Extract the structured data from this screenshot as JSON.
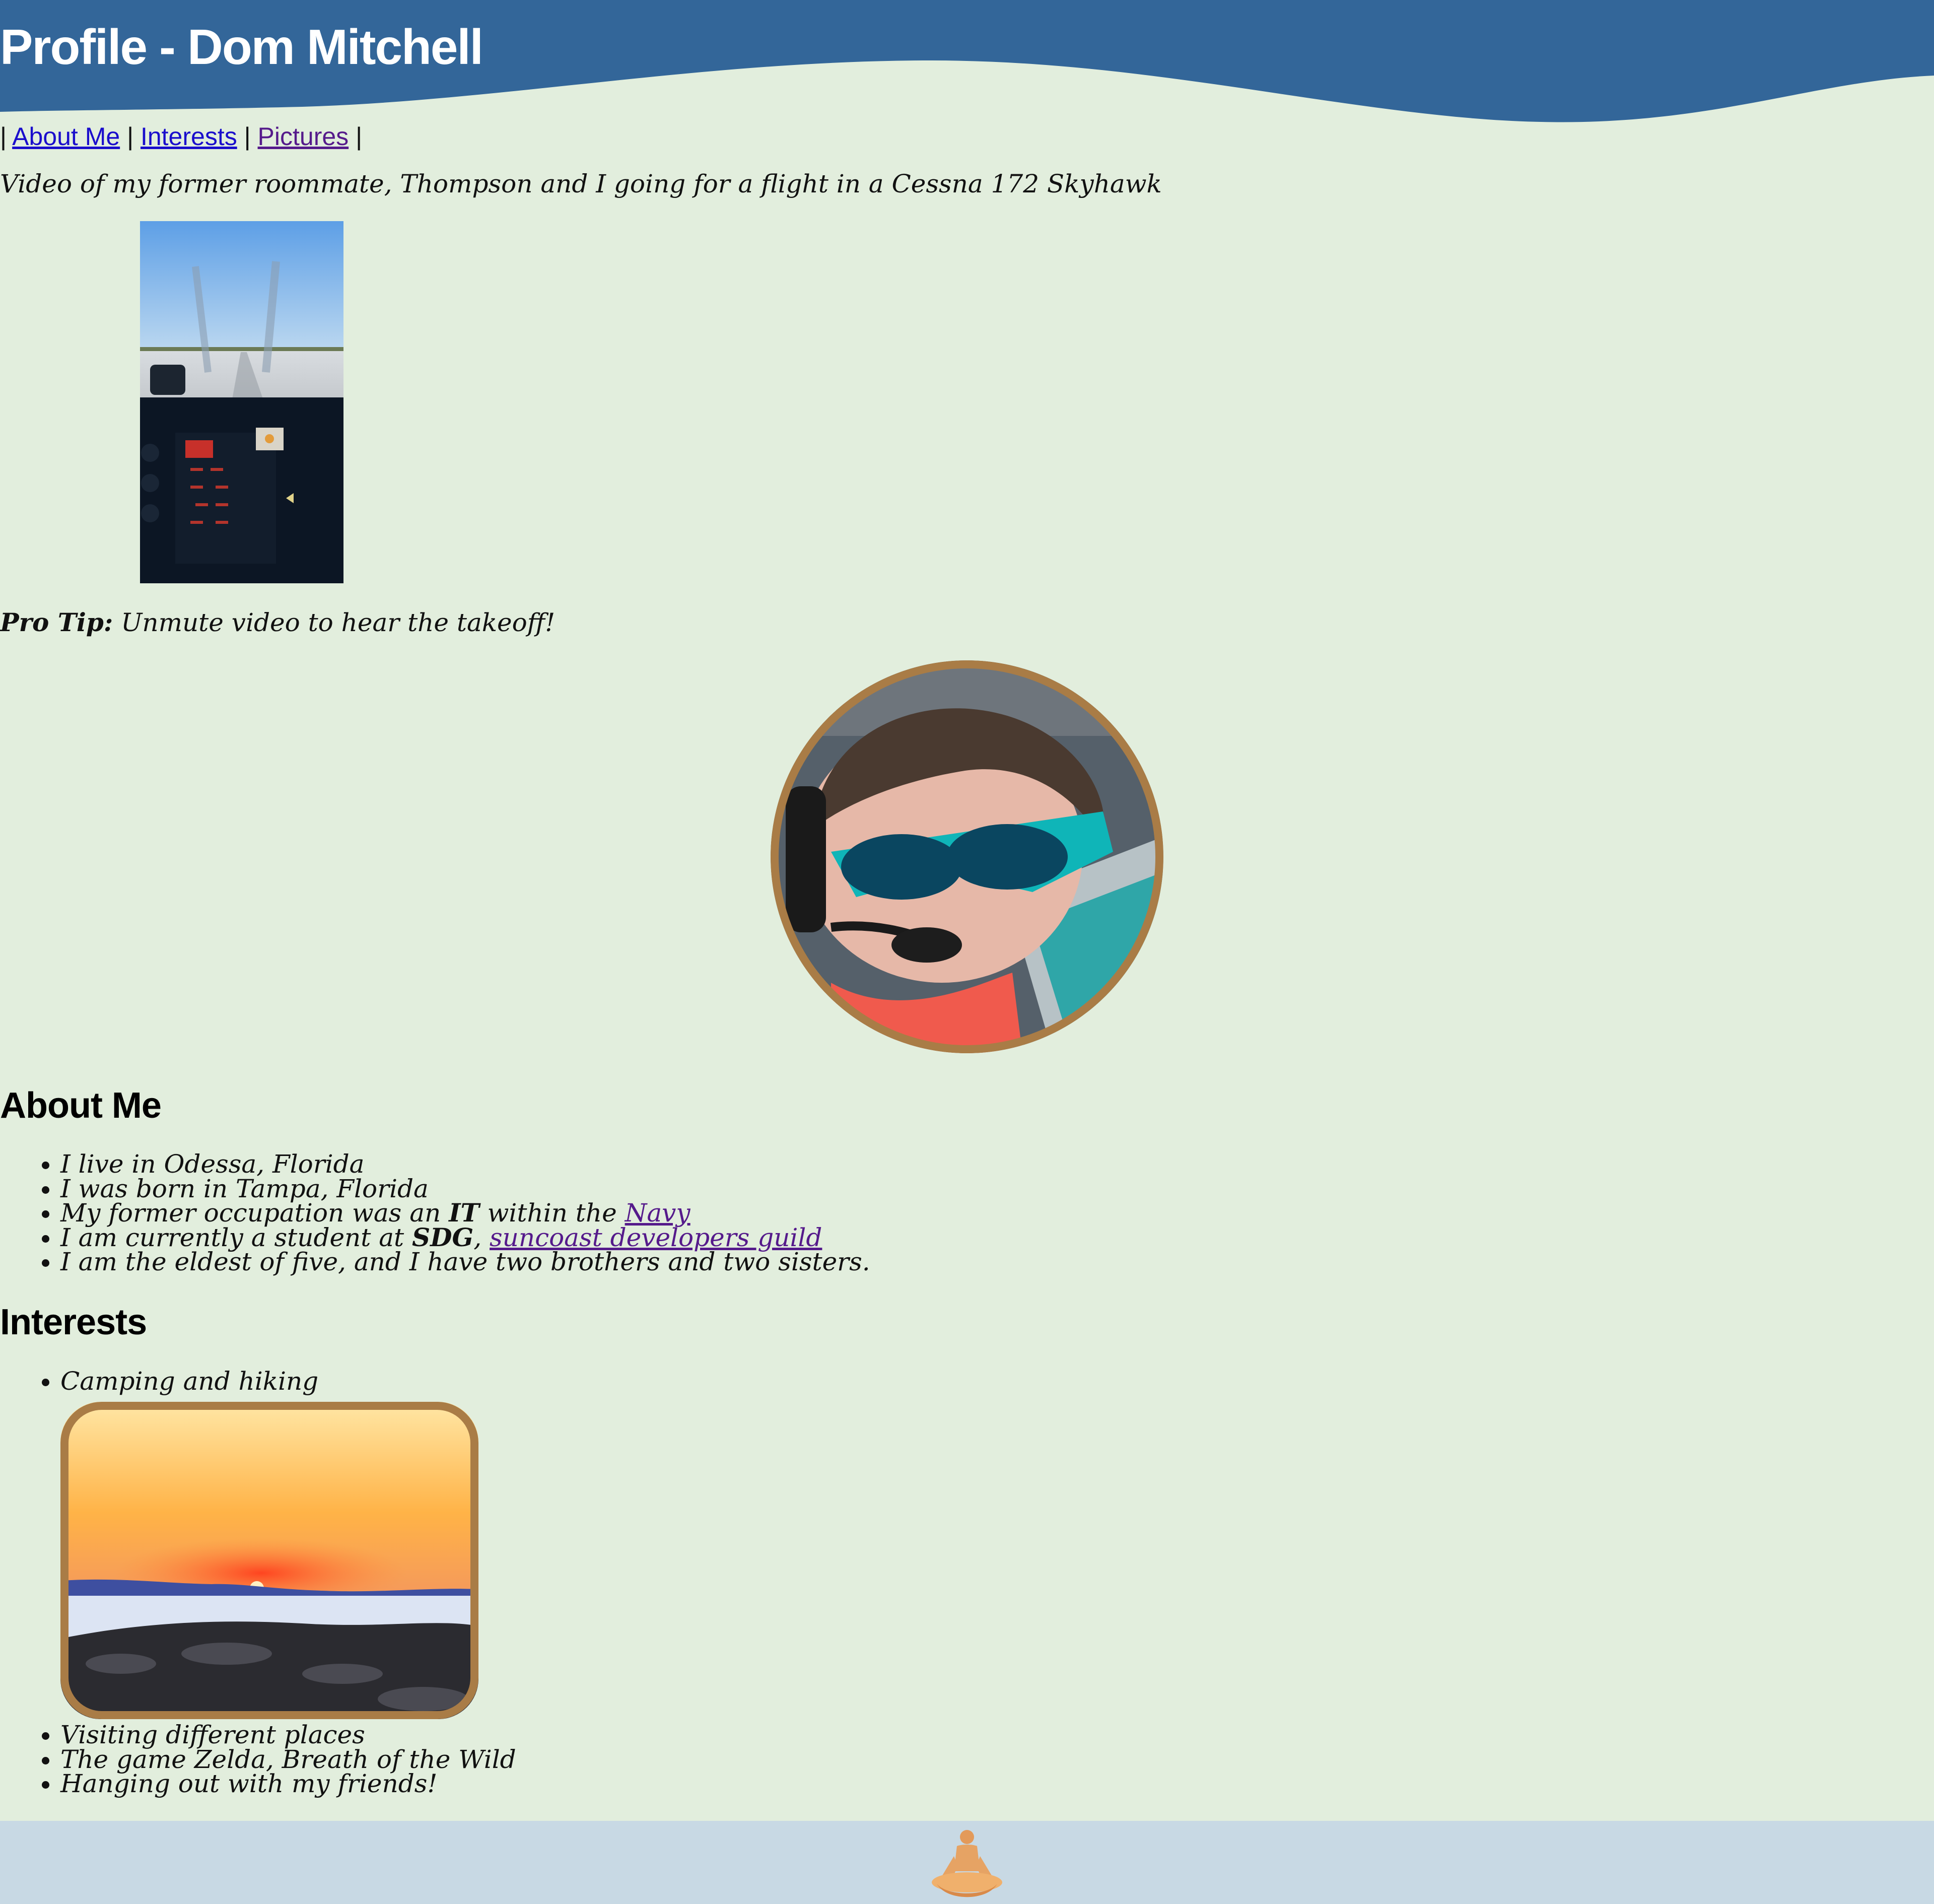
{
  "header": {
    "title": "Profile - Dom Mitchell",
    "bg_color": "#336699"
  },
  "nav": {
    "separator": "|",
    "links": [
      {
        "label": "About Me"
      },
      {
        "label": "Interests"
      },
      {
        "label": "Pictures"
      }
    ]
  },
  "video": {
    "caption": "Video of my former roommate, Thompson and I going for a flight in a Cessna 172 Skyhawk",
    "protip_label": "Pro Tip:",
    "protip_text": " Unmute video to hear the takeoff!"
  },
  "avatar": {
    "border_color": "#a97c46"
  },
  "about": {
    "heading": "About Me",
    "items": {
      "live": "I live in Odessa, Florida",
      "born": "I was born in Tampa, Florida",
      "occupation_pre": "My former occupation was an ",
      "occupation_bold": "IT",
      "occupation_mid": " within the ",
      "occupation_link": "Navy",
      "student_pre": "I am currently a student at ",
      "student_bold": "SDG",
      "student_mid": ", ",
      "student_link": "suncoast developers guild",
      "family": "I am the eldest of five, and I have two brothers and two sisters."
    }
  },
  "interests": {
    "heading": "Interests",
    "items": [
      "Camping and hiking",
      "Visiting different places",
      "The game Zelda, Breath of the Wild",
      "Hanging out with my friends!"
    ]
  },
  "colors": {
    "page_bg": "#e2eedd",
    "footer_bg": "#c8d9e4",
    "link": "#1a0dcc",
    "visited_link": "#551a8b",
    "image_border": "#a97c46"
  }
}
